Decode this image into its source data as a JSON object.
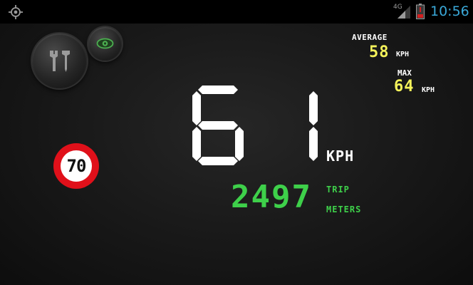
{
  "status_bar": {
    "network_type": "4G",
    "time": "10:56",
    "icons": [
      "gps-icon",
      "signal-icon",
      "battery-icon"
    ]
  },
  "controls": {
    "settings_icon": "tools-icon",
    "hud_icon": "eye-icon"
  },
  "speed_limit": {
    "value": "70"
  },
  "speed": {
    "value": "61",
    "unit": "KPH"
  },
  "average": {
    "label": "AVERAGE",
    "value": "58",
    "unit": "KPH"
  },
  "max": {
    "label": "MAX",
    "value": "64",
    "unit": "KPH"
  },
  "trip": {
    "value": "2497",
    "label": "TRIP",
    "unit": "METERS"
  },
  "colors": {
    "speed": "#ffffff",
    "stats": "#f4f25a",
    "trip": "#3ed04a",
    "speed_limit_ring": "#e0101a",
    "clock": "#3aa8d8",
    "battery_low": "#d42020",
    "hud_eye": "#4caf50"
  }
}
